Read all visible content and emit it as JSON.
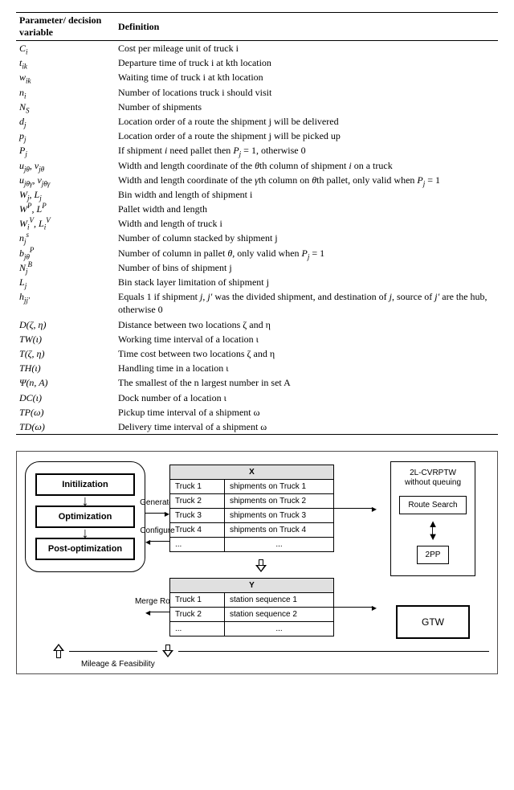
{
  "table": {
    "header_param": "Parameter/ decision variable",
    "header_def": "Definition",
    "rows": [
      {
        "sym": "C_i",
        "def": "Cost per mileage unit of truck i"
      },
      {
        "sym": "t_ik",
        "def": "Departure time of truck i at kth location"
      },
      {
        "sym": "w_ik",
        "def": "Waiting time of truck i at kth location"
      },
      {
        "sym": "n_i",
        "def": "Number of locations truck i should visit"
      },
      {
        "sym": "N_S",
        "def": "Number of shipments"
      },
      {
        "sym": "d_j",
        "def": "Location order of a route the shipment j will be delivered"
      },
      {
        "sym": "p_j",
        "def": "Location order of a route the shipment j will be picked up"
      },
      {
        "sym": "P_j",
        "def": "If shipment i need pallet then P_j = 1, otherwise 0"
      },
      {
        "sym": "u_jθ, v_jθ",
        "def": "Width and length coordinate of the θth column of shipment i on a truck"
      },
      {
        "sym": "u_jθγ, v_jθγ",
        "def": "Width and length coordinate of the γth column on θth pallet, only valid when P_j = 1"
      },
      {
        "sym": "W_j, L_j",
        "def": "Bin width and length of shipment i"
      },
      {
        "sym": "W^P, L^P",
        "def": "Pallet width and length"
      },
      {
        "sym": "W_i^V, L_i^V",
        "def": "Width and length of truck i"
      },
      {
        "sym": "n_j^s",
        "def": "Number of column stacked by shipment j"
      },
      {
        "sym": "b_jθ^P",
        "def": "Number of column in pallet θ, only valid when P_j = 1"
      },
      {
        "sym": "N_j^B",
        "def": "Number of bins of shipment j"
      },
      {
        "sym": "L_j",
        "def": "Bin stack layer limitation of shipment j"
      },
      {
        "sym": "h_jj'",
        "def": "Equals 1 if shipment j, j′ was the divided shipment, and destination of j, source of j′ are the hub, otherwise 0"
      },
      {
        "sym": "D(ζ, η)",
        "def": "Distance between two locations ζ and η"
      },
      {
        "sym": "TW(ι)",
        "def": "Working time interval of a location ι"
      },
      {
        "sym": "T(ζ, η)",
        "def": "Time cost between two locations ζ and η"
      },
      {
        "sym": "TH(ι)",
        "def": "Handling time in a location ι"
      },
      {
        "sym": "Ψ(n, A)",
        "def": "The smallest of the n largest number in set A"
      },
      {
        "sym": "DC(ι)",
        "def": "Dock number of a location ι"
      },
      {
        "sym": "TP(ω)",
        "def": "Pickup time interval of a shipment ω"
      },
      {
        "sym": "TD(ω)",
        "def": "Delivery time interval of a shipment ω"
      }
    ]
  },
  "fig": {
    "stages": {
      "init": "Initilization",
      "opt": "Optimization",
      "post": "Post-optimization"
    },
    "labels": {
      "generate": "Generate",
      "configure": "Configure",
      "merge": "Merge Rows",
      "mileage": "Mileage & Feasibility"
    },
    "x": {
      "title": "X",
      "rows": [
        {
          "k": "Truck 1",
          "v": "shipments on Truck 1"
        },
        {
          "k": "Truck 2",
          "v": "shipments on Truck 2"
        },
        {
          "k": "Truck 3",
          "v": "shipments on Truck 3"
        },
        {
          "k": "Truck 4",
          "v": "shipments on Truck 4"
        },
        {
          "k": "...",
          "v": "..."
        }
      ]
    },
    "y": {
      "title": "Y",
      "rows": [
        {
          "k": "Truck 1",
          "v": "station sequence 1"
        },
        {
          "k": "Truck 2",
          "v": "station sequence 2"
        },
        {
          "k": "...",
          "v": "..."
        }
      ]
    },
    "right": {
      "title_line1": "2L-CVRPTW",
      "title_line2": "without queuing",
      "route": "Route Search",
      "twopp": "2PP",
      "gtw": "GTW"
    }
  }
}
